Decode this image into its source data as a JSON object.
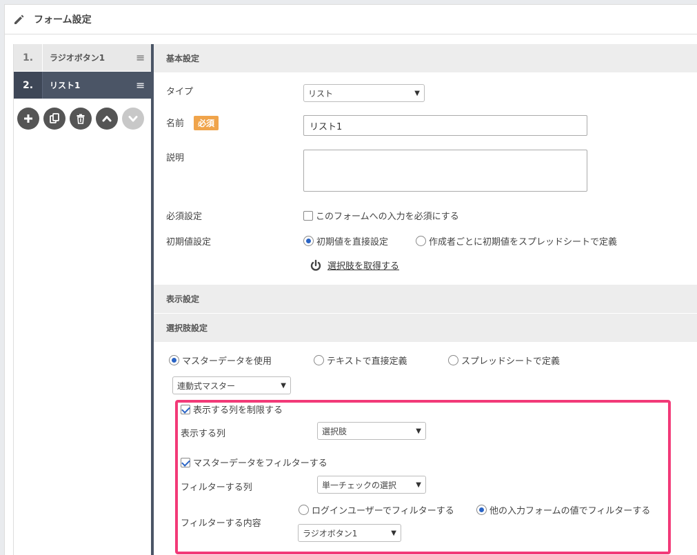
{
  "header": {
    "title": "フォーム設定",
    "icon": "pencil-icon"
  },
  "sidebar": {
    "items": [
      {
        "num": "1.",
        "label": "ラジオボタン1",
        "active": false
      },
      {
        "num": "2.",
        "label": "リスト1",
        "active": true
      }
    ],
    "menu_glyph": "≡",
    "tools": [
      "add-icon",
      "copy-icon",
      "trash-icon",
      "move-up-icon",
      "move-down-icon"
    ]
  },
  "basic": {
    "header": "基本設定",
    "type_label": "タイプ",
    "type_value": "リスト",
    "name_label": "名前",
    "required_badge": "必須",
    "name_value": "リスト1",
    "desc_label": "説明",
    "required_label": "必須設定",
    "required_option": "このフォームへの入力を必須にする",
    "initial_label": "初期値設定",
    "initial_opt1": "初期値を直接設定",
    "initial_opt2": "作成者ごとに初期値をスプレッドシートで定義",
    "fetch_link": "選択肢を取得する"
  },
  "display": {
    "header": "表示設定"
  },
  "choices": {
    "header": "選択肢設定",
    "opt_master": "マスターデータを使用",
    "opt_text": "テキストで直接定義",
    "opt_sheet": "スプレッドシートで定義",
    "master_select": "連動式マスター",
    "limit_cols": "表示する列を制限する",
    "cols_label": "表示する列",
    "cols_value": "選択肢",
    "filter_master": "マスターデータをフィルターする",
    "filter_col_label": "フィルターする列",
    "filter_col_value": "単一チェックの選択",
    "filter_content_label": "フィルターする内容",
    "filter_opt_login": "ログインユーザーでフィルターする",
    "filter_opt_other": "他の入力フォームの値でフィルターする",
    "filter_form_value": "ラジオボタン1"
  },
  "colors": {
    "highlight": "#f23a78",
    "sidebar_active": "#4b5566",
    "badge": "#f0a44b",
    "radio": "#2a64c5"
  }
}
